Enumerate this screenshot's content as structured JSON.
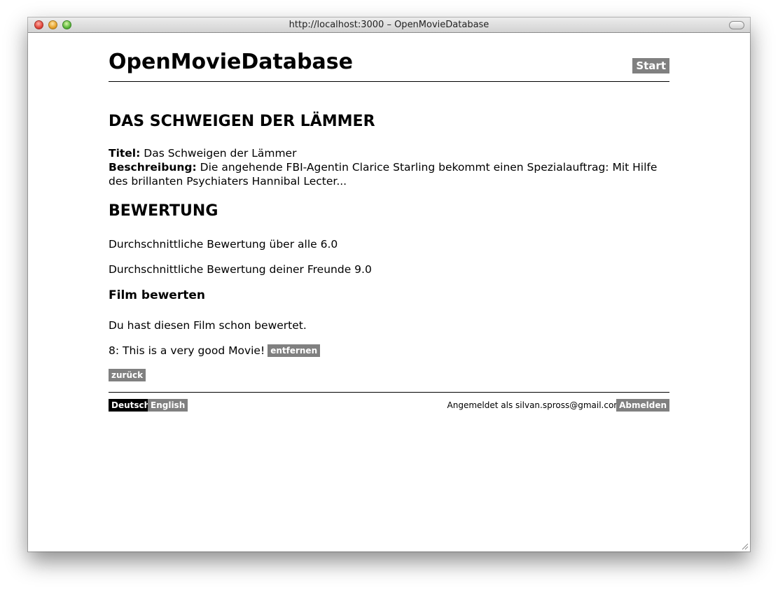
{
  "window": {
    "title": "http://localhost:3000 – OpenMovieDatabase"
  },
  "header": {
    "site_title": "OpenMovieDatabase",
    "start_label": "Start"
  },
  "movie": {
    "heading": "DAS SCHWEIGEN DER LÄMMER",
    "title_label": "Titel:",
    "title_value": "Das Schweigen der Lämmer",
    "description_label": "Beschreibung:",
    "description_value": "Die angehende FBI-Agentin Clarice Starling bekommt einen Spezialauftrag: Mit Hilfe des brillanten Psychiaters Hannibal Lecter..."
  },
  "rating": {
    "heading": "BEWERTUNG",
    "avg_all_label": "Durchschnittliche Bewertung über alle",
    "avg_all_value": "6.0",
    "avg_friends_label": "Durchschnittliche Bewertung deiner Freunde",
    "avg_friends_value": "9.0",
    "rate_heading": "Film bewerten",
    "already_rated": "Du hast diesen Film schon bewertet.",
    "own_rating": "8: This is a very good Movie!",
    "remove_label": "entfernen",
    "back_label": "zurück"
  },
  "footer": {
    "lang_de": "Deutsch",
    "lang_en": "English",
    "logged_in_as": "Angemeldet als silvan.spross@gmail.com",
    "logout_label": "Abmelden"
  },
  "colors": {
    "button_gray": "#808080",
    "active_lang": "#000000",
    "text": "#000000"
  }
}
